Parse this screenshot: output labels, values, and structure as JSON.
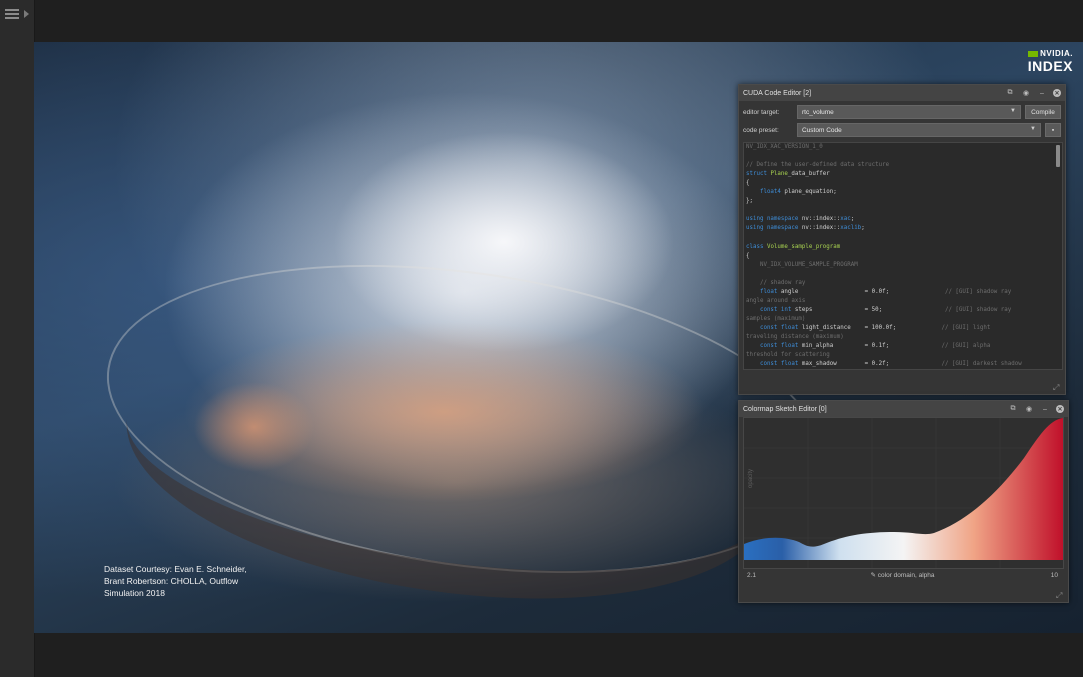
{
  "left_rail": {
    "menu_icon": "hamburger-icon",
    "expand_icon": "chevron-right-icon"
  },
  "viewport": {
    "credit_lines": [
      "Dataset Courtesy: Evan E. Schneider,",
      "Brant Robertson: CHOLLA, Outflow",
      "Simulation 2018"
    ],
    "logo": {
      "brand": "NVIDIA.",
      "product": "INDEX"
    }
  },
  "code_editor": {
    "title": "CUDA Code Editor [2]",
    "editor_target_label": "editor target:",
    "editor_target_value": "rtc_volume",
    "compile_label": "Compile",
    "code_preset_label": "code preset:",
    "code_preset_value": "Custom Code",
    "code_lines": [
      [
        {
          "t": "NV_IDX_XAC_VERSION_1_0",
          "c": "cm"
        }
      ],
      [],
      [
        {
          "t": "// Define the user-defined data structure",
          "c": "cm"
        }
      ],
      [
        {
          "t": "struct ",
          "c": "kw"
        },
        {
          "t": "Plane",
          "c": "ty"
        },
        {
          "t": "_data_buffer",
          "c": ""
        }
      ],
      [
        {
          "t": "{",
          "c": ""
        }
      ],
      [
        {
          "t": "    float4 ",
          "c": "kw"
        },
        {
          "t": "plane_equation;",
          "c": ""
        }
      ],
      [
        {
          "t": "};",
          "c": ""
        }
      ],
      [],
      [
        {
          "t": "using namespace ",
          "c": "kw"
        },
        {
          "t": "nv::index::",
          "c": ""
        },
        {
          "t": "xac",
          "c": "kw"
        },
        {
          "t": ";",
          "c": ""
        }
      ],
      [
        {
          "t": "using namespace ",
          "c": "kw"
        },
        {
          "t": "nv::index::",
          "c": ""
        },
        {
          "t": "xaclib",
          "c": "kw"
        },
        {
          "t": ";",
          "c": ""
        }
      ],
      [],
      [
        {
          "t": "class ",
          "c": "kw"
        },
        {
          "t": "Volume_sample_program",
          "c": "ty"
        }
      ],
      [
        {
          "t": "{",
          "c": ""
        }
      ],
      [
        {
          "t": "    NV_IDX_VOLUME_SAMPLE_PROGRAM",
          "c": "cm"
        }
      ],
      [],
      [
        {
          "t": "    // shadow ray",
          "c": "cm"
        }
      ],
      [
        {
          "t": "    float ",
          "c": "kw"
        },
        {
          "t": "angle                   = 0.0f;",
          "c": ""
        },
        {
          "t": "                // [GUI] shadow ray",
          "c": "cm"
        }
      ],
      [
        {
          "t": "angle around axis",
          "c": "cm"
        }
      ],
      [
        {
          "t": "    const int ",
          "c": "kw"
        },
        {
          "t": "steps               = 50;",
          "c": ""
        },
        {
          "t": "                  // [GUI] shadow ray",
          "c": "cm"
        }
      ],
      [
        {
          "t": "samples (maximum)",
          "c": "cm"
        }
      ],
      [
        {
          "t": "    const float ",
          "c": "kw"
        },
        {
          "t": "light_distance    = 100.0f;",
          "c": ""
        },
        {
          "t": "             // [GUI] light",
          "c": "cm"
        }
      ],
      [
        {
          "t": "traveling distance (maximum)",
          "c": "cm"
        }
      ],
      [
        {
          "t": "    const float ",
          "c": "kw"
        },
        {
          "t": "min_alpha         = 0.1f;",
          "c": ""
        },
        {
          "t": "               // [GUI] alpha",
          "c": "cm"
        }
      ],
      [
        {
          "t": "threshold for scattering",
          "c": "cm"
        }
      ],
      [
        {
          "t": "    const float ",
          "c": "kw"
        },
        {
          "t": "max_shadow        = 0.2f;",
          "c": ""
        },
        {
          "t": "               // [GUI] darkest shadow",
          "c": "cm"
        }
      ]
    ]
  },
  "colormap_editor": {
    "title": "Colormap Sketch Editor [0]",
    "y_axis_label": "opacity",
    "domain_min": "2.1",
    "domain_max": "10",
    "footer_label": "color domain, alpha",
    "colors": {
      "low": "#2a6fc0",
      "mid": "#f4f4f4",
      "high": "#c0102a"
    }
  }
}
